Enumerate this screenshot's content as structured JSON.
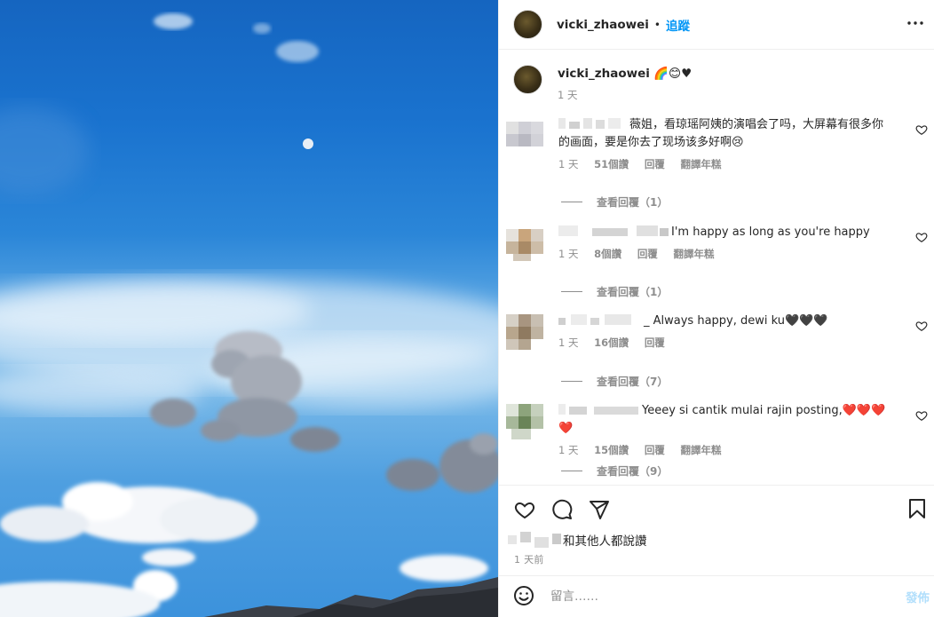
{
  "header": {
    "username": "vicki_zhaowei",
    "separator": "•",
    "follow_label": "追蹤",
    "more_icon": "ellipsis-icon"
  },
  "caption": {
    "username": "vicki_zhaowei",
    "text": "🌈😊♥",
    "time": "1 天"
  },
  "comments": [
    {
      "text_line1": "薇姐，看琼瑶阿姨的演唱会了吗，大屏幕有很多你",
      "text_line2": "的画面，要是你去了现场该多好啊😢",
      "time": "1 天",
      "likes": "51個讚",
      "reply": "回覆",
      "translate": "翻譯年糕",
      "view_replies": "查看回覆（1）"
    },
    {
      "text_line1": "I'm happy as long as you're happy￼￼￼",
      "time": "1 天",
      "likes": "8個讚",
      "reply": "回覆",
      "translate": "翻譯年糕",
      "view_replies": "查看回覆（1）"
    },
    {
      "text_line1": "_ Always happy, dewi ku🖤🖤🖤",
      "time": "1 天",
      "likes": "16個讚",
      "reply": "回覆",
      "view_replies": "查看回覆（7）"
    },
    {
      "text_line1": "Yeeey si cantik mulai rajin posting,❤️❤️❤️❤️",
      "time": "1 天",
      "likes": "15個讚",
      "reply": "回覆",
      "translate": "翻譯年糕",
      "view_replies": "查看回覆（9）"
    }
  ],
  "actions": {
    "like_icon": "heart-icon",
    "comment_icon": "comment-icon",
    "share_icon": "paper-plane-icon",
    "save_icon": "bookmark-icon",
    "likes_text": "和其他人都說讚",
    "post_time": "1 天前"
  },
  "add_comment": {
    "placeholder": "留言……",
    "post_label": "發佈",
    "emoji_icon": "smiley-icon"
  },
  "colors": {
    "accent": "#0095f6",
    "muted": "#8e8e8e",
    "border": "#efefef"
  }
}
